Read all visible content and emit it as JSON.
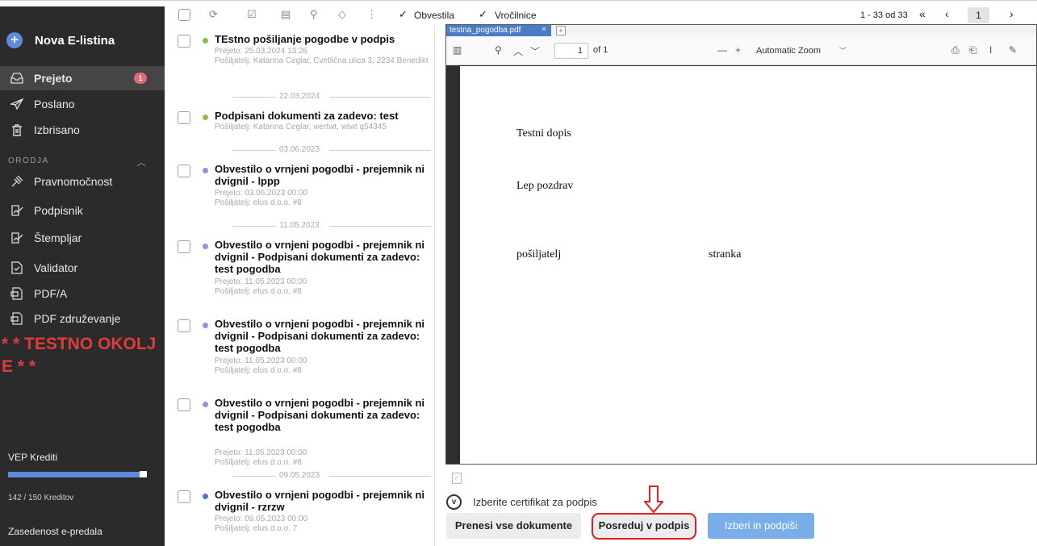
{
  "sidebar": {
    "new_label": "Nova E-listina",
    "items": [
      {
        "label": "Prejeto",
        "icon": "inbox-icon",
        "badge": "1"
      },
      {
        "label": "Poslano",
        "icon": "send-icon"
      },
      {
        "label": "Izbrisano",
        "icon": "trash-icon"
      }
    ],
    "section_label": "ORODJA",
    "tools": [
      {
        "label": "Pravnomočnost",
        "icon": "gavel-icon"
      },
      {
        "label": "Podpisnik",
        "icon": "signature-icon"
      },
      {
        "label": "Štempljar",
        "icon": "stamp-icon"
      },
      {
        "label": "Validator",
        "icon": "file-check-icon"
      },
      {
        "label": "PDF/A",
        "icon": "pdf-icon"
      },
      {
        "label": "PDF združevanje",
        "icon": "pdf-merge-icon"
      }
    ],
    "test_env": "* * TESTNO OKOLJE * *",
    "credits_label": "VEP Krediti",
    "credits_used": 142,
    "credits_total": 150,
    "credits_text": "142 / 150 Kreditov",
    "occupancy_label": "Zasedenost e-predala"
  },
  "toolbar": {
    "filter_notices": "Obvestila",
    "filter_deliveries": "Vročilnice",
    "pager_text": "1 - 33 od 33",
    "current_page": "1"
  },
  "messages": [
    {
      "title": "TEstno pošiljanje pogodbe v podpis",
      "received": "Prejeto: 25.03.2024 13:26",
      "sender": "Pošiljatelj: Katarina Ceglar, Cvetlična ulica 3, 2234 Benedikt",
      "dot_color": "#8dbf48"
    },
    {
      "title": "Podpisani dokumenti za zadevo: test",
      "received": "",
      "sender": "Pošiljatelj: Katarina Ceglar, wertwt, wtwt q54345",
      "dot_color": "#8dbf48"
    },
    {
      "title": "Obvestilo o vrnjeni pogodbi - prejemnik ni dvignil - lppp",
      "received": "Prejeto: 03.06.2023 00:00",
      "sender": "Pošiljatelj: elus d.o.o. #8",
      "dot_color": "#9b8fe3"
    },
    {
      "title": "Obvestilo o vrnjeni pogodbi - prejemnik ni dvignil - Podpisani dokumenti za zadevo: test pogodba",
      "received": "Prejeto: 11.05.2023 00:00",
      "sender": "Pošiljatelj: elus d.o.o. #8",
      "dot_color": "#9b8fe3"
    },
    {
      "title": "Obvestilo o vrnjeni pogodbi - prejemnik ni dvignil - Podpisani dokumenti za zadevo: test pogodba",
      "received": "Prejeto: 11.05.2023 00:00",
      "sender": "Pošiljatelj: elus d.o.o. #8",
      "dot_color": "#9b8fe3"
    },
    {
      "title": "Obvestilo o vrnjeni pogodbi - prejemnik ni dvignil - Podpisani dokumenti za zadevo: test pogodba",
      "received": "Prejeto: 11.05.2023 00:00",
      "sender": "Pošiljatelj: elus d.o.o. #8",
      "dot_color": "#9b8fe3"
    },
    {
      "title": "Obvestilo o vrnjeni pogodbi - prejemnik ni dvignil - rzrzw",
      "received": "Prejeto: 09.05.2023 00:00",
      "sender": "Pošiljatelj: elus d.o.o. 7",
      "dot_color": "#4b77c9"
    }
  ],
  "date_separators": [
    "22.03.2024",
    "03.06.2023",
    "11.05.2023",
    "09.05.2023"
  ],
  "viewer": {
    "tab_filename": "testna_pogodba.pdf",
    "page_number": "1",
    "page_of": "of 1",
    "zoom": "Automatic Zoom",
    "doc": {
      "line1": "Testni dopis",
      "line2": "Lep pozdrav",
      "sender": "pošiljatelj",
      "party": "stranka"
    }
  },
  "actions": {
    "cert_label": "Izberite certifikat za podpis",
    "download_all": "Prenesi vse dokumente",
    "forward_sign": "Posreduj v podpis",
    "choose_sign": "Izberi in podpiši"
  },
  "colors": {
    "sidebar_bg": "#2b2b2b",
    "accent": "#5e8be0",
    "test_env": "#e23b3b",
    "highlight": "#e02020",
    "primary_button": "#7aaeea"
  }
}
